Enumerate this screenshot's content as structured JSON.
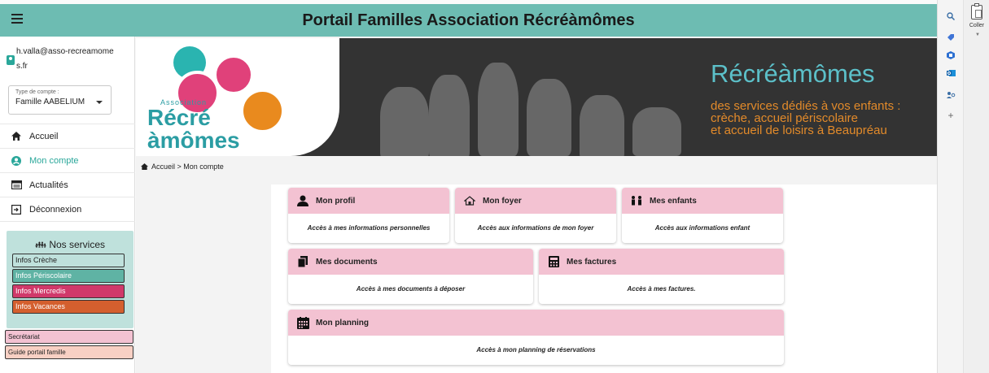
{
  "header": {
    "title": "Portail Familles Association Récréàmômes"
  },
  "user": {
    "email": "h.valla@asso-recreamomes.fr",
    "account_type_label": "Type de compte :",
    "account_type_value": "Famille AABELIUM"
  },
  "nav": {
    "items": [
      {
        "label": "Accueil",
        "icon": "home-icon"
      },
      {
        "label": "Mon compte",
        "icon": "account-circle-icon",
        "active": true
      },
      {
        "label": "Actualités",
        "icon": "newspaper-icon"
      },
      {
        "label": "Déconnexion",
        "icon": "logout-icon"
      }
    ]
  },
  "services": {
    "title": "Nos services",
    "items": [
      {
        "label": "Infos Crèche",
        "color": "#bfe1dc"
      },
      {
        "label": "Infos Périscolaire",
        "color": "#5fb3a4"
      },
      {
        "label": "Infos Mercredis",
        "color": "#d0396a"
      },
      {
        "label": "Infos Vacances",
        "color": "#d45f2e"
      }
    ]
  },
  "extra_links": {
    "secretariat": "Secrétariat",
    "guide": "Guide portail famille"
  },
  "banner": {
    "logo_association": "Association",
    "logo_line1": "Récré",
    "logo_line2": "àmômes",
    "title": "Récréàmômes",
    "subtitle_line1": "des services dédiés à vos enfants :",
    "subtitle_line2": "crèche, accueil périscolaire",
    "subtitle_line3": "et accueil de loisirs à Beaupréau"
  },
  "breadcrumb": {
    "text": "Accueil > Mon compte"
  },
  "cards": {
    "profil": {
      "title": "Mon profil",
      "desc": "Accès à mes informations personnelles"
    },
    "foyer": {
      "title": "Mon foyer",
      "desc": "Accès aux informations de mon foyer"
    },
    "enfants": {
      "title": "Mes enfants",
      "desc": "Accès aux informations enfant"
    },
    "documents": {
      "title": "Mes documents",
      "desc": "Accès à mes documents à déposer"
    },
    "factures": {
      "title": "Mes factures",
      "desc": "Accès à mes factures."
    },
    "planning": {
      "title": "Mon planning",
      "desc": "Accès à mon planning de réservations"
    }
  },
  "office": {
    "paste_label": "Coller"
  },
  "colors": {
    "teal": "#6dbcb2",
    "pink": "#f3c2d2",
    "banner_dark": "#333333",
    "title_teal": "#5cc0c9",
    "orange": "#e28a2a"
  }
}
